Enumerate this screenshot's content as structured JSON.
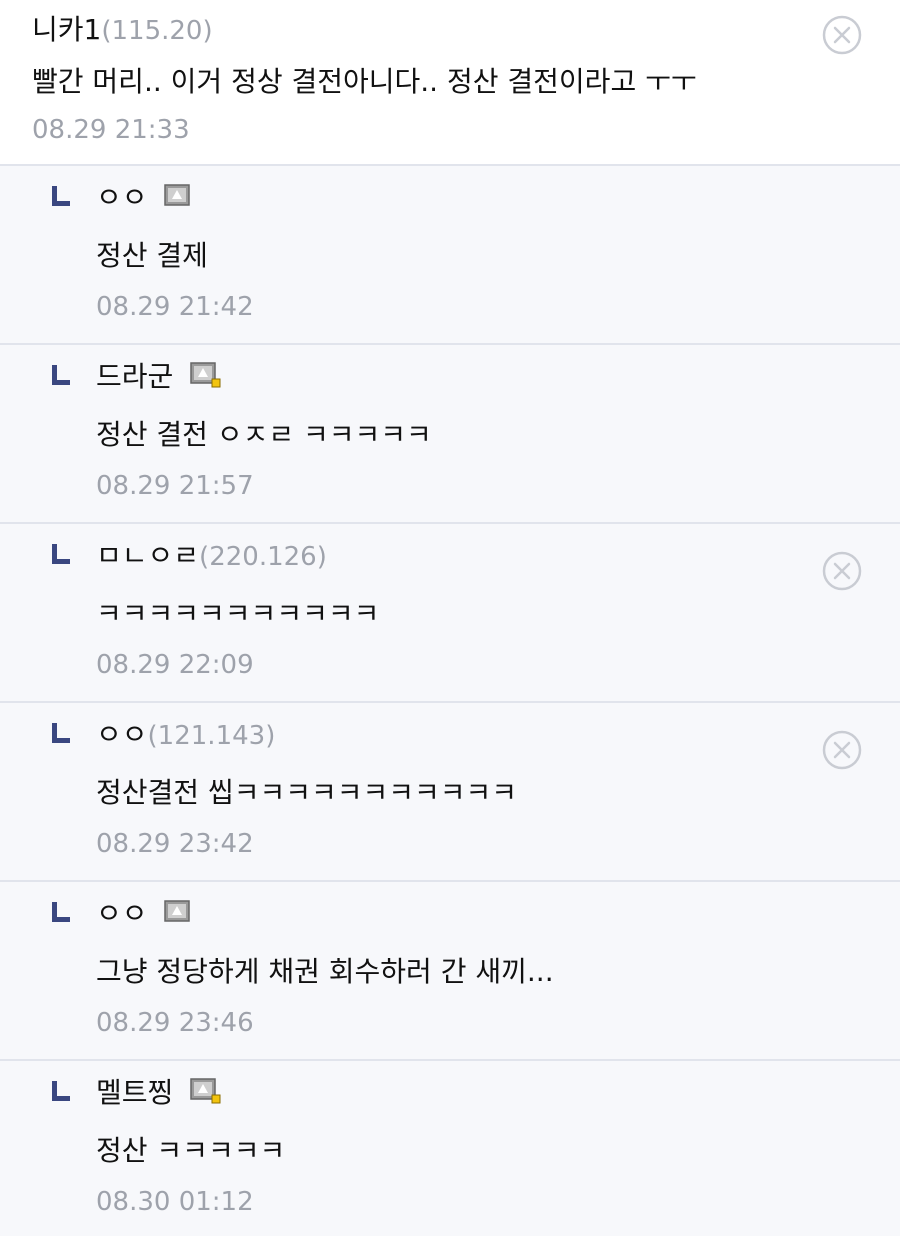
{
  "root_comment": {
    "author": "니카1",
    "ip": "(115.20)",
    "text": "빨간 머리.. 이거 정상 결전아니다.. 정산 결전이라고 ㅜㅜ",
    "time": "08.29 21:33",
    "delete_icon": "close-circle-icon"
  },
  "replies": [
    {
      "author": "ㅇㅇ",
      "ip": "",
      "badge": "gallog-fixed-icon",
      "text": "정산 결제",
      "time": "08.29 21:42"
    },
    {
      "author": "드라군",
      "ip": "",
      "badge": "gallog-fixed-sub-icon",
      "text": "정산 결전 ㅇㅈㄹ ㅋㅋㅋㅋㅋ",
      "time": "08.29 21:57"
    },
    {
      "author": "ㅁㄴㅇㄹ",
      "ip": "(220.126)",
      "badge": "",
      "text": "ㅋㅋㅋㅋㅋㅋㅋㅋㅋㅋㅋ",
      "time": "08.29 22:09"
    },
    {
      "author": "ㅇㅇ",
      "ip": "(121.143)",
      "badge": "",
      "text": "정산결전 씹ㅋㅋㅋㅋㅋㅋㅋㅋㅋㅋㅋ",
      "time": "08.29 23:42"
    },
    {
      "author": "ㅇㅇ",
      "ip": "",
      "badge": "gallog-fixed-icon",
      "text": "그냥 정당하게 채권 회수하러 간 새끼...",
      "time": "08.29 23:46"
    },
    {
      "author": "멜트찡",
      "ip": "",
      "badge": "gallog-fixed-sub-icon",
      "text": "정산 ㅋㅋㅋㅋㅋ",
      "time": "08.30 01:12"
    }
  ],
  "colors": {
    "background": "#f7f8fb",
    "root_background": "#ffffff",
    "divider": "#e1e4ec",
    "meta_gray": "#9ea2ab",
    "reply_marker": "#3a4780",
    "badge_yellow": "#f2c40f"
  }
}
